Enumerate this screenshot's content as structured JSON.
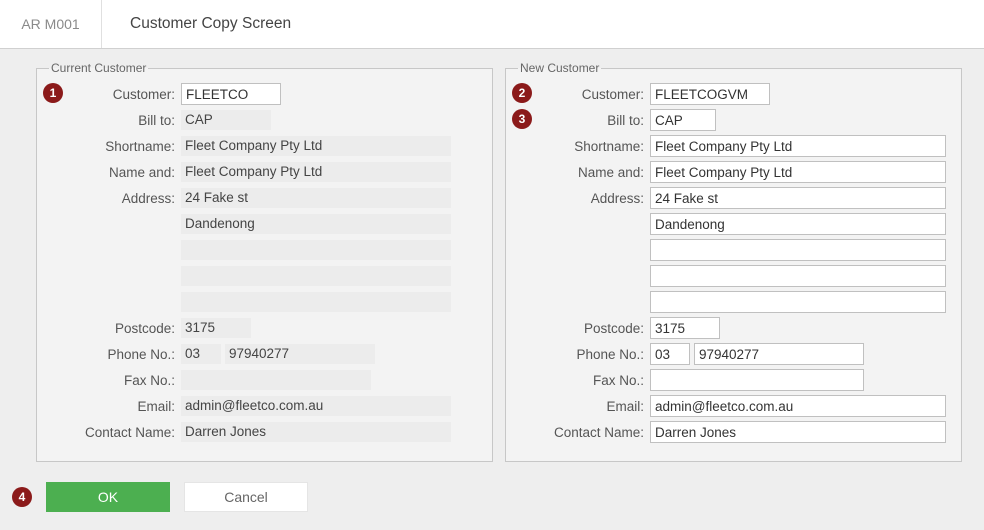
{
  "header": {
    "code": "AR M001",
    "title": "Customer Copy Screen"
  },
  "markers": {
    "m1": "1",
    "m2": "2",
    "m3": "3",
    "m4": "4"
  },
  "current": {
    "legend": "Current Customer",
    "labels": {
      "customer": "Customer:",
      "billto": "Bill to:",
      "shortname": "Shortname:",
      "nameand": "Name and:",
      "address": "Address:",
      "postcode": "Postcode:",
      "phone": "Phone No.:",
      "fax": "Fax No.:",
      "email": "Email:",
      "contact": "Contact Name:"
    },
    "values": {
      "customer": "FLEETCO",
      "billto": "CAP",
      "shortname": "Fleet Company Pty Ltd",
      "nameand": "Fleet Company Pty Ltd",
      "address1": "24 Fake st",
      "address2": "Dandenong",
      "address3": "",
      "address4": "",
      "address5": "",
      "postcode": "3175",
      "phone_area": "03",
      "phone_num": "97940277",
      "fax": "",
      "email": "admin@fleetco.com.au",
      "contact": "Darren Jones"
    }
  },
  "new": {
    "legend": "New Customer",
    "labels": {
      "customer": "Customer:",
      "billto": "Bill to:",
      "shortname": "Shortname:",
      "nameand": "Name and:",
      "address": "Address:",
      "postcode": "Postcode:",
      "phone": "Phone No.:",
      "fax": "Fax No.:",
      "email": "Email:",
      "contact": "Contact Name:"
    },
    "values": {
      "customer": "FLEETCOGVM",
      "billto": "CAP",
      "shortname": "Fleet Company Pty Ltd",
      "nameand": "Fleet Company Pty Ltd",
      "address1": "24 Fake st",
      "address2": "Dandenong",
      "address3": "",
      "address4": "",
      "address5": "",
      "postcode": "3175",
      "phone_area": "03",
      "phone_num": "97940277",
      "fax": "",
      "email": "admin@fleetco.com.au",
      "contact": "Darren Jones"
    }
  },
  "footer": {
    "ok": "OK",
    "cancel": "Cancel"
  }
}
